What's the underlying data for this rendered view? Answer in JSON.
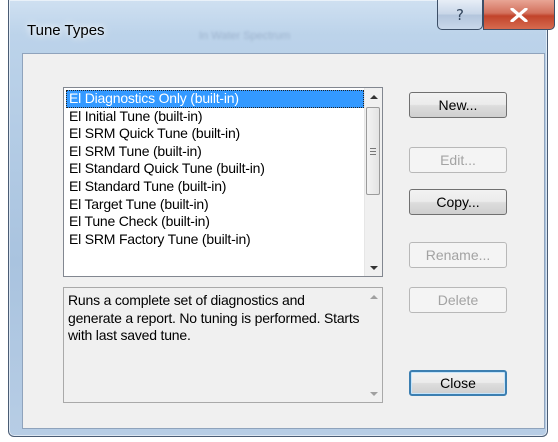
{
  "window": {
    "title": "Tune Types",
    "background_title": "In Water Spectrum",
    "help_glyph": "?",
    "close_glyph": "close-x-icon"
  },
  "list": {
    "items": [
      {
        "label": "El Diagnostics Only (built-in)",
        "selected": true
      },
      {
        "label": "El Initial Tune (built-in)",
        "selected": false
      },
      {
        "label": "El SRM Quick Tune (built-in)",
        "selected": false
      },
      {
        "label": "El SRM Tune (built-in)",
        "selected": false
      },
      {
        "label": "El Standard Quick Tune (built-in)",
        "selected": false
      },
      {
        "label": "El Standard Tune (built-in)",
        "selected": false
      },
      {
        "label": "El Target Tune (built-in)",
        "selected": false
      },
      {
        "label": "El Tune Check (built-in)",
        "selected": false
      },
      {
        "label": "El SRM Factory Tune (built-in)",
        "selected": false
      }
    ]
  },
  "description": {
    "text": "Runs a complete set of diagnostics and generate a report. No tuning is performed. Starts with last saved tune."
  },
  "buttons": {
    "new": {
      "label": "New...",
      "enabled": true
    },
    "edit": {
      "label": "Edit...",
      "enabled": false
    },
    "copy": {
      "label": "Copy...",
      "enabled": true
    },
    "rename": {
      "label": "Rename...",
      "enabled": false
    },
    "delete": {
      "label": "Delete",
      "enabled": false
    },
    "close": {
      "label": "Close",
      "enabled": true
    }
  },
  "colors": {
    "selection": "#3399ff",
    "close_button": "#c1432b",
    "frame": "#a9c3df"
  }
}
